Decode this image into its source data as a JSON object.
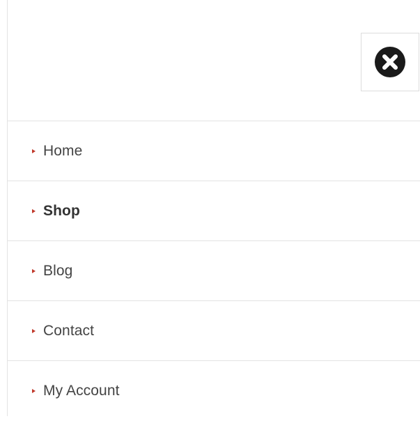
{
  "header": {
    "close_icon": "close-circle-icon"
  },
  "menu": {
    "arrow_color": "#c0392b",
    "items": [
      {
        "label": "Home",
        "active": false
      },
      {
        "label": "Shop",
        "active": true
      },
      {
        "label": "Blog",
        "active": false
      },
      {
        "label": "Contact",
        "active": false
      },
      {
        "label": "My Account",
        "active": false
      }
    ]
  }
}
